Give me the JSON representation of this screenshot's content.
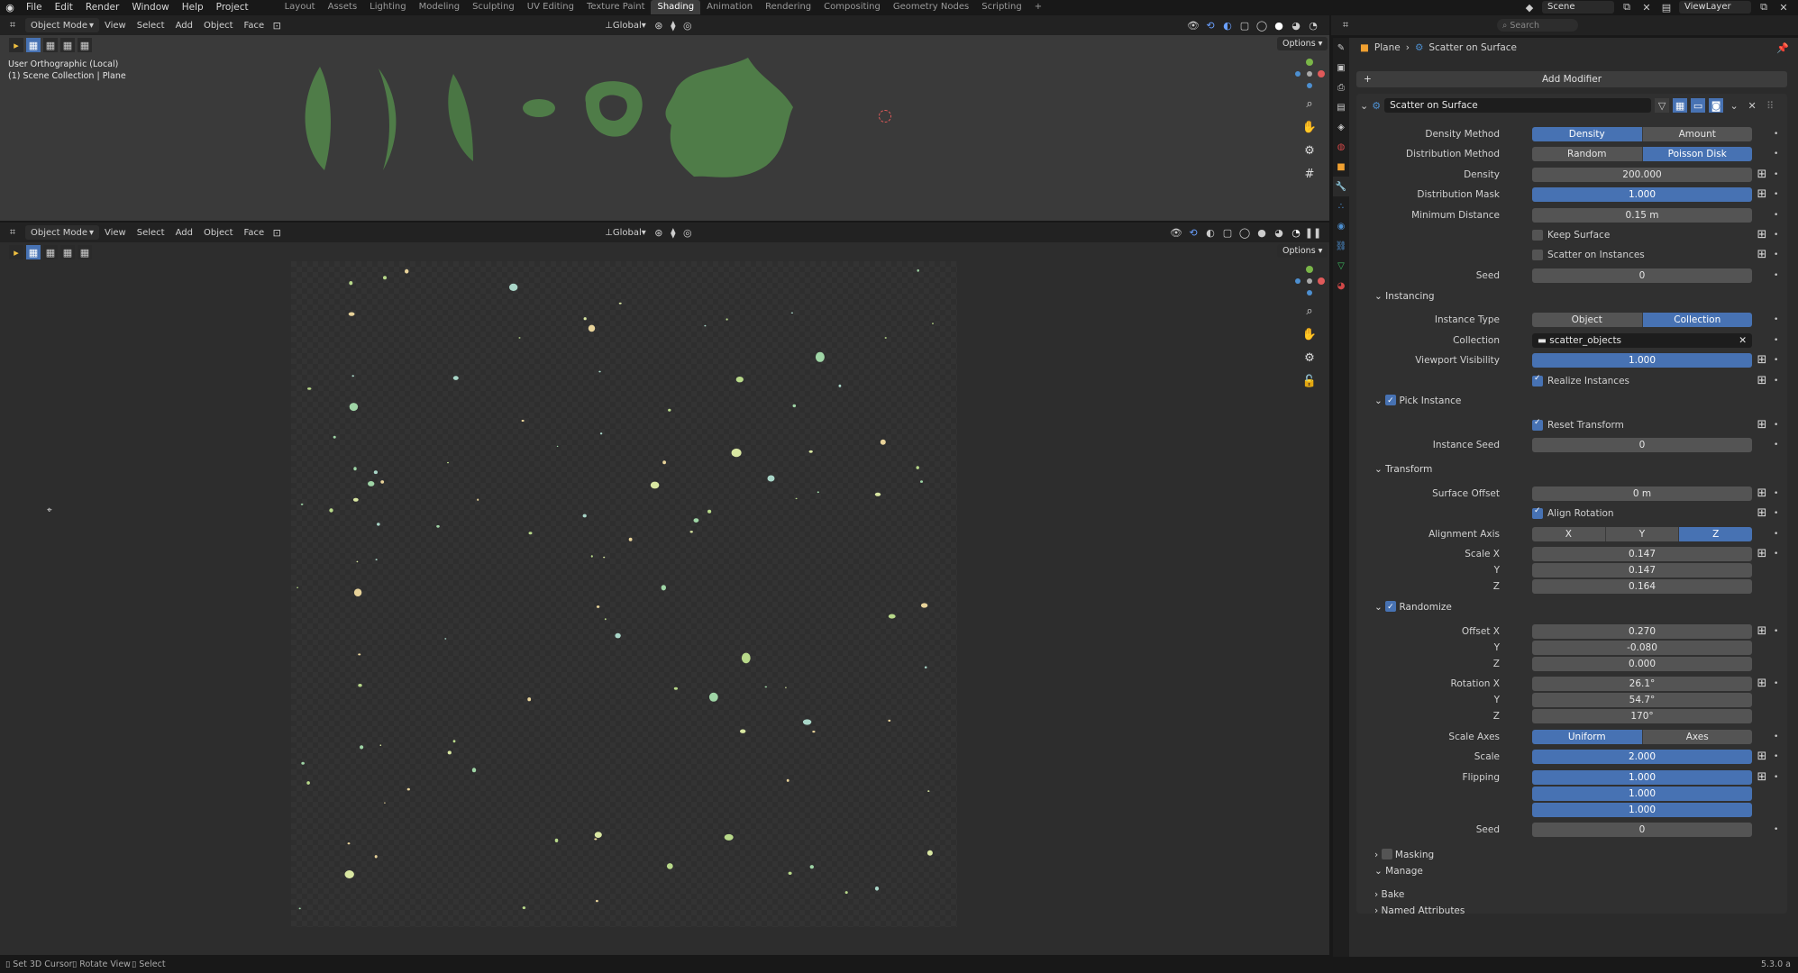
{
  "topbar": {
    "menu": [
      "File",
      "Edit",
      "Render",
      "Window",
      "Help",
      "Project"
    ],
    "workspaces": [
      "Layout",
      "Assets",
      "Lighting",
      "Modeling",
      "Sculpting",
      "UV Editing",
      "Texture Paint",
      "Shading",
      "Animation",
      "Rendering",
      "Compositing",
      "Geometry Nodes",
      "Scripting",
      "+"
    ],
    "active_workspace": "Shading",
    "scene": "Scene",
    "view_layer": "ViewLayer"
  },
  "viewport_header": {
    "mode": "Object Mode",
    "menus": [
      "View",
      "Select",
      "Add",
      "Object",
      "Face"
    ],
    "transform_orientation": "Global",
    "options_label": "Options"
  },
  "viewport_top": {
    "view_name": "User Orthographic (Local)",
    "collection_path": "(1) Scene Collection | Plane"
  },
  "properties": {
    "search_placeholder": "Search",
    "breadcrumb_object": "Plane",
    "breadcrumb_modifier": "Scatter on Surface",
    "add_modifier": "Add Modifier",
    "modifier_name": "Scatter on Surface",
    "density_method": {
      "label": "Density Method",
      "options": [
        "Density",
        "Amount"
      ],
      "selected": "Density"
    },
    "distribution_method": {
      "label": "Distribution Method",
      "options": [
        "Random",
        "Poisson Disk"
      ],
      "selected": "Poisson Disk"
    },
    "density": {
      "label": "Density",
      "value": "200.000"
    },
    "distribution_mask": {
      "label": "Distribution Mask",
      "value": "1.000"
    },
    "minimum_distance": {
      "label": "Minimum Distance",
      "value": "0.15 m"
    },
    "keep_surface": {
      "label": "Keep Surface",
      "checked": false
    },
    "scatter_on_instances": {
      "label": "Scatter on Instances",
      "checked": false
    },
    "seed": {
      "label": "Seed",
      "value": "0"
    },
    "instancing": {
      "header": "Instancing",
      "instance_type": {
        "label": "Instance Type",
        "options": [
          "Object",
          "Collection"
        ],
        "selected": "Collection"
      },
      "collection": {
        "label": "Collection",
        "value": "scatter_objects"
      },
      "viewport_visibility": {
        "label": "Viewport Visibility",
        "value": "1.000"
      },
      "realize_instances": {
        "label": "Realize Instances",
        "checked": true
      }
    },
    "pick_instance": {
      "header": "Pick Instance",
      "reset_transform": {
        "label": "Reset Transform",
        "checked": true
      },
      "instance_seed": {
        "label": "Instance Seed",
        "value": "0"
      }
    },
    "transform": {
      "header": "Transform",
      "surface_offset": {
        "label": "Surface Offset",
        "value": "0 m"
      },
      "align_rotation": {
        "label": "Align Rotation",
        "checked": true
      },
      "alignment_axis": {
        "label": "Alignment Axis",
        "options": [
          "X",
          "Y",
          "Z"
        ],
        "selected": "Z"
      },
      "scale_x": {
        "label": "Scale X",
        "value": "0.147"
      },
      "scale_y": {
        "label": "Y",
        "value": "0.147"
      },
      "scale_z": {
        "label": "Z",
        "value": "0.164"
      }
    },
    "randomize": {
      "header": "Randomize",
      "offset_x": {
        "label": "Offset X",
        "value": "0.270"
      },
      "offset_y": {
        "label": "Y",
        "value": "-0.080"
      },
      "offset_z": {
        "label": "Z",
        "value": "0.000"
      },
      "rotation_x": {
        "label": "Rotation X",
        "value": "26.1°"
      },
      "rotation_y": {
        "label": "Y",
        "value": "54.7°"
      },
      "rotation_z": {
        "label": "Z",
        "value": "170°"
      },
      "scale_axes": {
        "label": "Scale Axes",
        "options": [
          "Uniform",
          "Axes"
        ],
        "selected": "Uniform"
      },
      "scale": {
        "label": "Scale",
        "value": "2.000"
      },
      "flipping": {
        "label": "Flipping",
        "values": [
          "1.000",
          "1.000",
          "1.000"
        ]
      },
      "seed": {
        "label": "Seed",
        "value": "0"
      }
    },
    "masking": "Masking",
    "manage": "Manage",
    "bake": "Bake",
    "named_attributes": "Named Attributes"
  },
  "statusbar": {
    "items": [
      "Set 3D Cursor",
      "Rotate View",
      "Select"
    ],
    "version": "5.3.0 a"
  },
  "colors": {
    "accent": "#4772b3",
    "panel": "#2b2b2b",
    "viewport": "#3a3a3a",
    "mesh": "#4f7c48"
  }
}
